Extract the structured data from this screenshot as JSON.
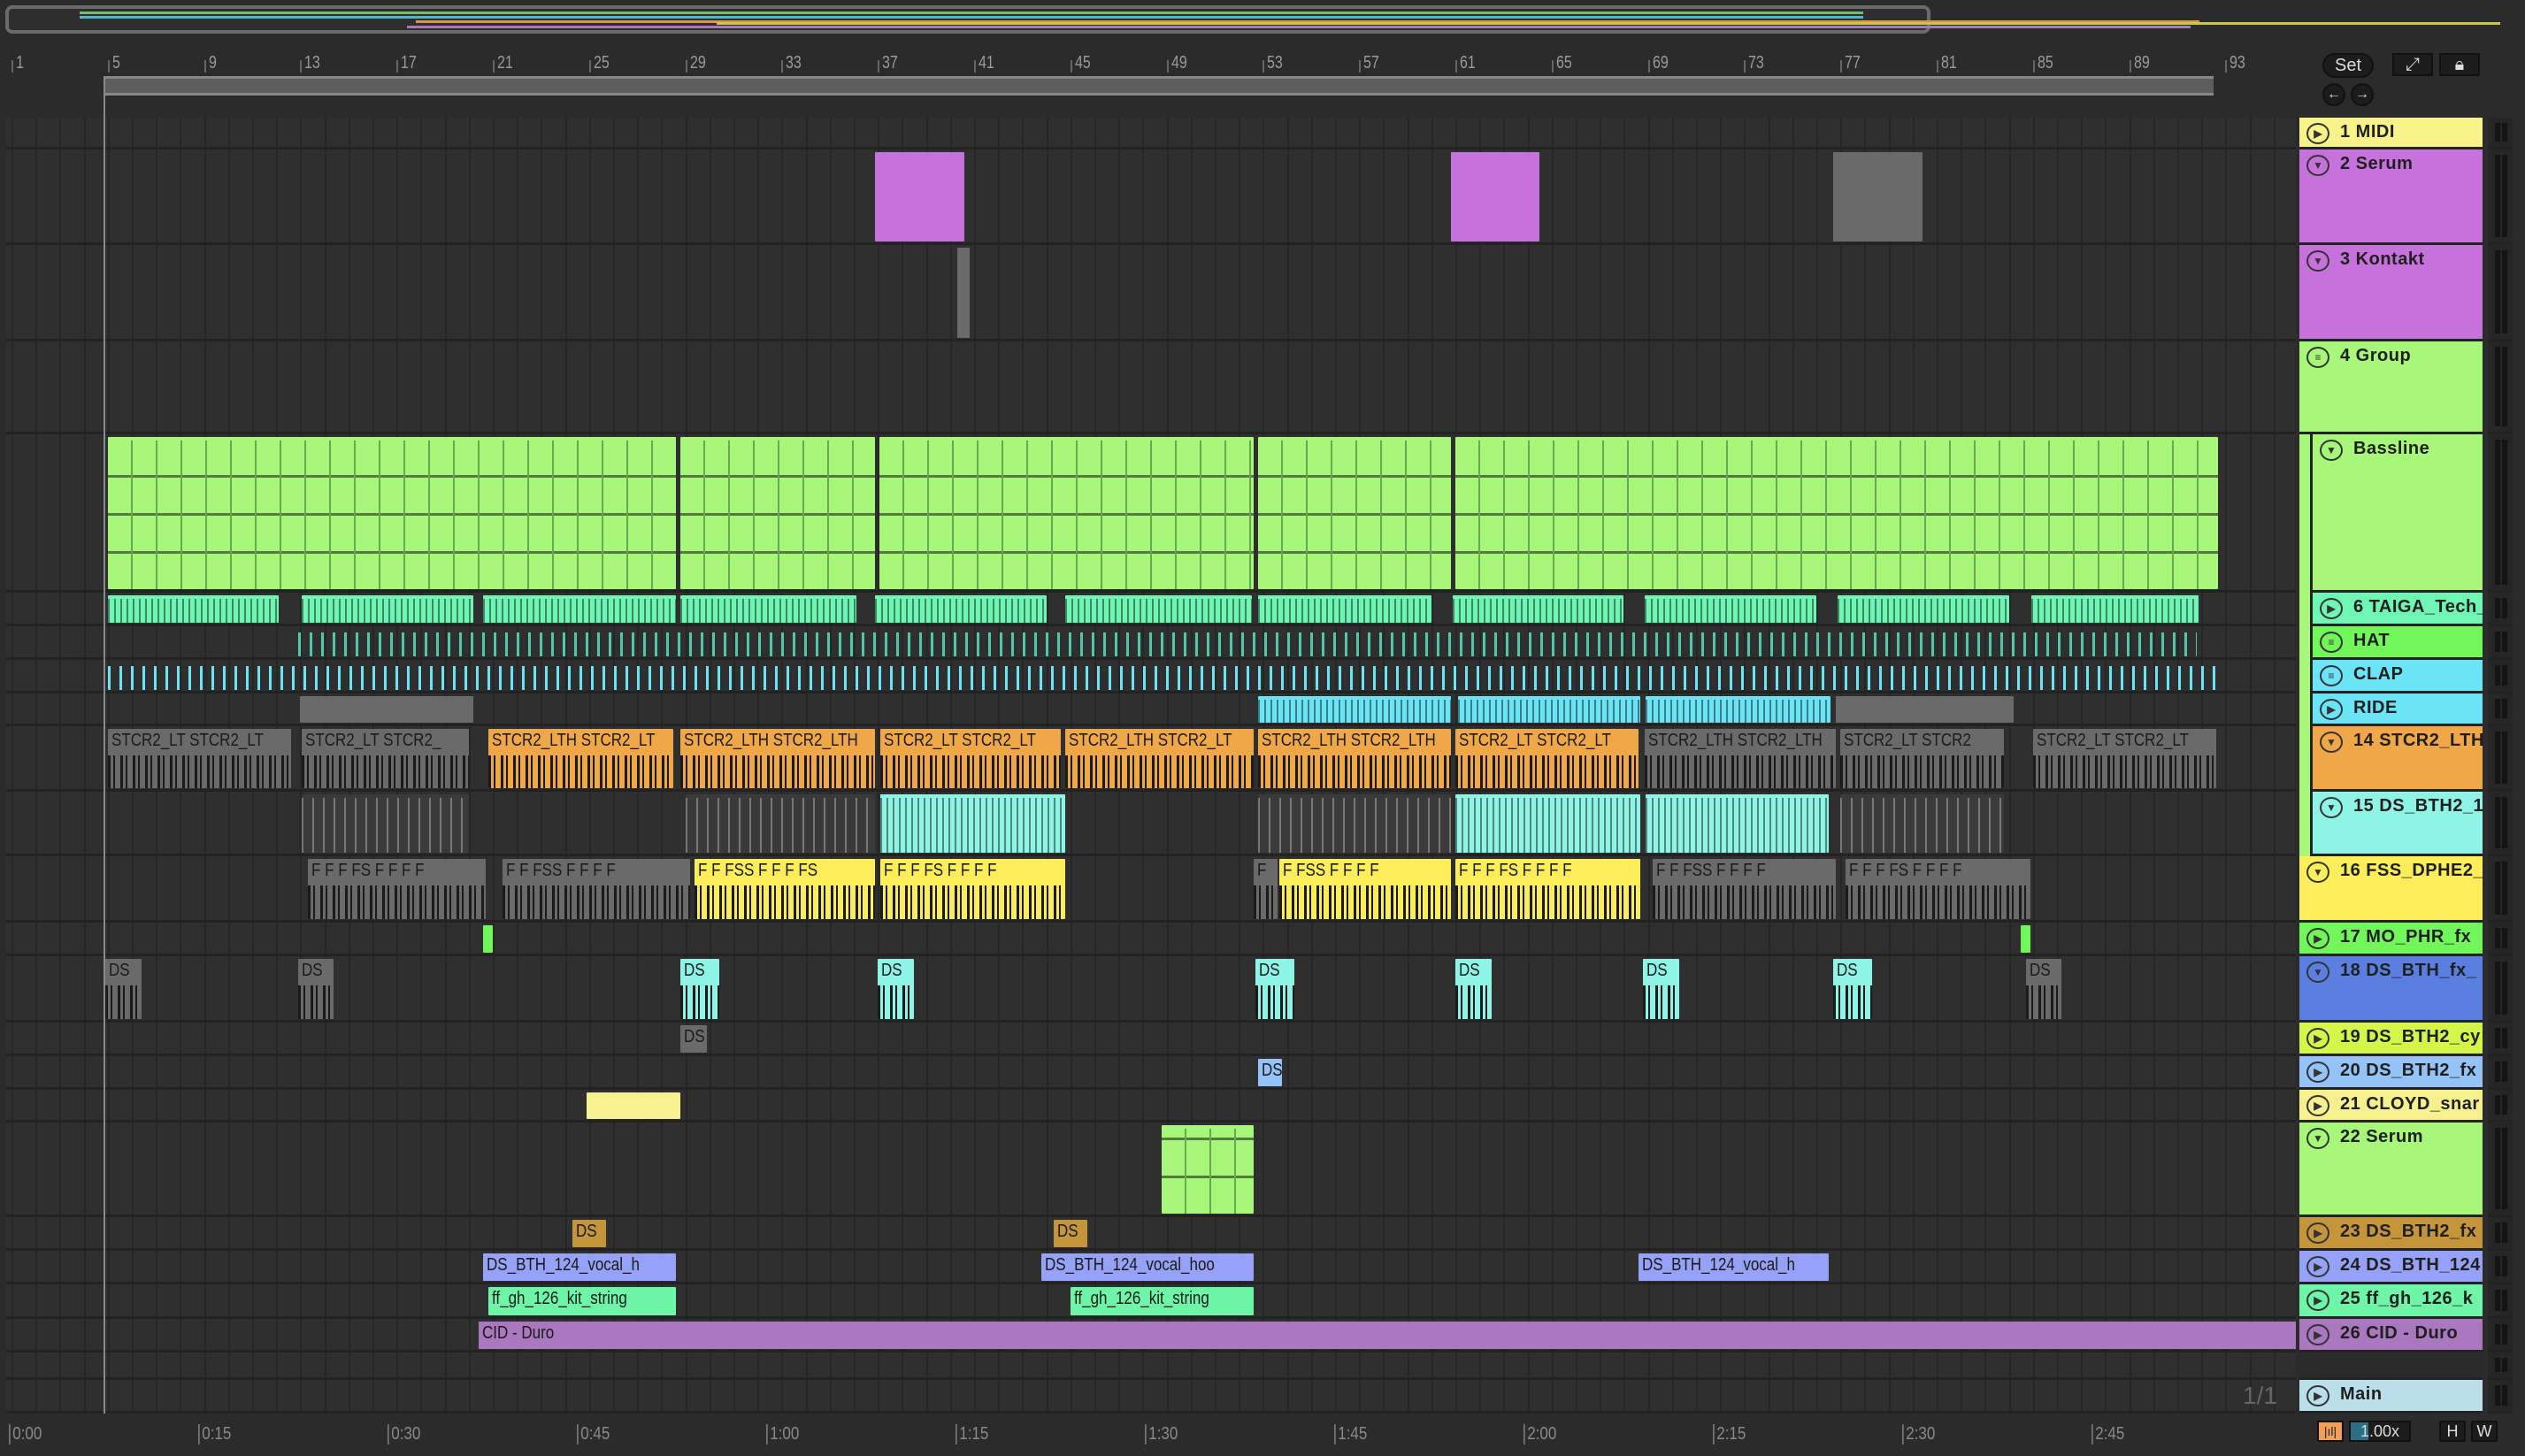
{
  "toolbar": {
    "set_label": "Set",
    "expand_icon": "expand-icon",
    "lock_icon": "lock-icon",
    "back_icon": "arrow-left-icon",
    "forward_icon": "arrow-right-icon"
  },
  "ruler": {
    "bars": [
      1,
      5,
      9,
      13,
      17,
      21,
      25,
      29,
      33,
      37,
      41,
      45,
      49,
      53,
      57,
      61,
      65,
      69,
      73,
      77,
      81,
      85,
      89,
      93
    ]
  },
  "time_ruler": {
    "labels": [
      "0:00",
      "0:15",
      "0:30",
      "0:45",
      "1:00",
      "1:15",
      "1:30",
      "1:45",
      "2:00",
      "2:15",
      "2:30",
      "2:45"
    ]
  },
  "pager": "1/1",
  "bottom": {
    "tempo_icon": "tempo-follow-icon",
    "zoom": "1.00x",
    "h_label": "H",
    "w_label": "W"
  },
  "tracks": [
    {
      "name": "1 MIDI",
      "color": "#f7f38a",
      "icon": "play",
      "clips": []
    },
    {
      "name": "2 Serum",
      "color": "#c772dc",
      "icon": "fold",
      "clips": [
        {
          "s": 36.9,
          "e": 40.6,
          "c": "#c772dc"
        },
        {
          "s": 60.8,
          "e": 64.5,
          "c": "#c772dc"
        },
        {
          "s": 76.7,
          "e": 80.4,
          "c": "#6a6a6a"
        }
      ]
    },
    {
      "name": "3 Kontakt",
      "color": "#c772dc",
      "icon": "fold",
      "clips": [
        {
          "s": 40.3,
          "e": 40.8,
          "c": "#6a6a6a"
        }
      ]
    },
    {
      "name": "4 Group",
      "color": "#a6f77a",
      "icon": "group",
      "clips": []
    },
    {
      "name": "Bassline",
      "color": "#a6f77a",
      "icon": "fold",
      "indent": true,
      "clips": [
        {
          "s": 5,
          "e": 28.6,
          "c": "#a6f77a",
          "w": "midi"
        },
        {
          "s": 28.8,
          "e": 36.9,
          "c": "#a6f77a",
          "w": "midi"
        },
        {
          "s": 37.05,
          "e": 52.6,
          "c": "#a6f77a",
          "w": "midi"
        },
        {
          "s": 52.8,
          "e": 60.8,
          "c": "#a6f77a",
          "w": "midi"
        },
        {
          "s": 61,
          "e": 92.7,
          "c": "#a6f77a",
          "w": "midi"
        }
      ]
    },
    {
      "name": "6 TAIGA_Tech_",
      "color": "#6ff5b4",
      "icon": "play",
      "indent": true,
      "clips": [
        {
          "s": 5,
          "e": 12.1,
          "c": "#6ff5b4",
          "w": "dense"
        },
        {
          "s": 13.05,
          "e": 20.2,
          "c": "#6ff5b4",
          "w": "dense"
        },
        {
          "s": 20.6,
          "e": 28.6,
          "c": "#6ff5b4",
          "w": "dense"
        },
        {
          "s": 28.8,
          "e": 36.1,
          "c": "#6ff5b4",
          "w": "dense"
        },
        {
          "s": 36.9,
          "e": 44,
          "c": "#6ff5b4",
          "w": "dense"
        },
        {
          "s": 44.8,
          "e": 52.55,
          "c": "#6ff5b4",
          "w": "dense"
        },
        {
          "s": 52.8,
          "e": 60,
          "c": "#6ff5b4",
          "w": "dense"
        },
        {
          "s": 60.9,
          "e": 68,
          "c": "#6ff5b4",
          "w": "dense"
        },
        {
          "s": 68.85,
          "e": 76,
          "c": "#6ff5b4",
          "w": "dense"
        },
        {
          "s": 76.9,
          "e": 84,
          "c": "#6ff5b4",
          "w": "dense"
        },
        {
          "s": 84.95,
          "e": 91.9,
          "c": "#6ff5b4",
          "w": "dense"
        }
      ]
    },
    {
      "name": "HAT",
      "color": "#72f75a",
      "icon": "group",
      "indent": true,
      "clips": [
        {
          "s": 12.9,
          "e": 91.8,
          "c": "#4fc7a8",
          "w": "hat"
        }
      ]
    },
    {
      "name": "CLAP",
      "color": "#6ce4f7",
      "icon": "group",
      "indent": true,
      "clips": [
        {
          "s": 5,
          "e": 92.7,
          "c": "#6ce4f7",
          "w": "hat"
        }
      ]
    },
    {
      "name": "RIDE",
      "color": "#6ce4f7",
      "icon": "play",
      "indent": true,
      "clips": [
        {
          "s": 13,
          "e": 20.2,
          "c": "#6a6a6a"
        },
        {
          "s": 52.8,
          "e": 60.8,
          "c": "#6ce4f7",
          "w": "dense"
        },
        {
          "s": 61.1,
          "e": 68.7,
          "c": "#6ce4f7",
          "w": "dense"
        },
        {
          "s": 68.9,
          "e": 76.6,
          "c": "#6ce4f7",
          "w": "dense"
        },
        {
          "s": 76.8,
          "e": 84.2,
          "c": "#6a6a6a"
        }
      ]
    },
    {
      "name": "14 STCR2_LTH",
      "color": "#f0a747",
      "icon": "fold",
      "indent": true,
      "clips": [
        {
          "s": 5,
          "e": 12.6,
          "c": "#6a6a6a",
          "l": "STCR2_LT STCR2_LT",
          "w": "audio"
        },
        {
          "s": 13.05,
          "e": 20,
          "c": "#6a6a6a",
          "l": "STCR2_LT STCR2_",
          "w": "audio"
        },
        {
          "s": 20.8,
          "e": 28.5,
          "c": "#f0a747",
          "l": "STCR2_LTH STCR2_LT",
          "w": "audio"
        },
        {
          "s": 28.8,
          "e": 36.9,
          "c": "#f0a747",
          "l": "STCR2_LTH STCR2_LTH",
          "w": "audio"
        },
        {
          "s": 37.1,
          "e": 44.6,
          "c": "#f0a747",
          "l": "STCR2_LT STCR2_LT",
          "w": "audio"
        },
        {
          "s": 44.8,
          "e": 52.6,
          "c": "#f0a747",
          "l": "STCR2_LTH STCR2_LT",
          "w": "audio"
        },
        {
          "s": 52.8,
          "e": 60.8,
          "c": "#f0a747",
          "l": "STCR2_LTH STCR2_LTH",
          "w": "audio"
        },
        {
          "s": 61,
          "e": 68.6,
          "c": "#f0a747",
          "l": "STCR2_LT STCR2_LT",
          "w": "audio"
        },
        {
          "s": 68.85,
          "e": 76.8,
          "c": "#6a6a6a",
          "l": "STCR2_LTH STCR2_LTH",
          "w": "audio"
        },
        {
          "s": 77,
          "e": 83.8,
          "c": "#6a6a6a",
          "l": "STCR2_LT STCR2",
          "w": "audio"
        },
        {
          "s": 85,
          "e": 92.6,
          "c": "#6a6a6a",
          "l": "STCR2_LT STCR2_LT",
          "w": "audio"
        }
      ]
    },
    {
      "name": "15 DS_BTH2_1",
      "color": "#8ef5e6",
      "icon": "fold",
      "indent": true,
      "clips": [
        {
          "s": 13.05,
          "e": 20,
          "c": "#3a3a3a",
          "w": "lines"
        },
        {
          "s": 29,
          "e": 36.9,
          "c": "#3a3a3a",
          "w": "lines"
        },
        {
          "s": 37.1,
          "e": 44.8,
          "c": "#8ef5e6",
          "w": "dense"
        },
        {
          "s": 52.8,
          "e": 60.8,
          "c": "#3a3a3a",
          "w": "lines"
        },
        {
          "s": 61,
          "e": 68.7,
          "c": "#8ef5e6",
          "w": "dense"
        },
        {
          "s": 68.9,
          "e": 76.5,
          "c": "#8ef5e6",
          "w": "dense"
        },
        {
          "s": 77,
          "e": 83.8,
          "c": "#3a3a3a",
          "w": "lines"
        }
      ]
    },
    {
      "name": "16 FSS_DPHE2_",
      "color": "#fcee5a",
      "icon": "fold",
      "clips": [
        {
          "s": 13.3,
          "e": 20.7,
          "c": "#6a6a6a",
          "l": "F  F  F FS  F  F  F F",
          "w": "audio"
        },
        {
          "s": 21.4,
          "e": 29.2,
          "c": "#6a6a6a",
          "l": "F  F  FSS  F  F  F F",
          "w": "audio"
        },
        {
          "s": 29.4,
          "e": 36.9,
          "c": "#fcee5a",
          "l": "F  F  FSS  F  F  F FS",
          "w": "audio"
        },
        {
          "s": 37.1,
          "e": 44.8,
          "c": "#fcee5a",
          "l": "F  F  F FS  F  F  F F",
          "w": "audio"
        },
        {
          "s": 52.6,
          "e": 53.6,
          "c": "#6a6a6a",
          "l": "F",
          "w": "audio"
        },
        {
          "s": 53.7,
          "e": 60.8,
          "c": "#fcee5a",
          "l": "F  FSS  F  F  F F",
          "w": "audio"
        },
        {
          "s": 61,
          "e": 68.7,
          "c": "#fcee5a",
          "l": "F  F  F FS  F  F  F F",
          "w": "audio"
        },
        {
          "s": 69.2,
          "e": 76.8,
          "c": "#6a6a6a",
          "l": "F  F  FSS  F  F  F F",
          "w": "audio"
        },
        {
          "s": 77.2,
          "e": 84.9,
          "c": "#6a6a6a",
          "l": "F  F  F FS  F  F  F F",
          "w": "audio"
        }
      ]
    },
    {
      "name": "17 MO_PHR_fx",
      "color": "#72f75a",
      "icon": "play",
      "clips": [
        {
          "s": 20.6,
          "e": 21,
          "c": "#72f75a"
        },
        {
          "s": 84.5,
          "e": 84.9,
          "c": "#72f75a"
        }
      ]
    },
    {
      "name": "18 DS_BTH_fx_",
      "color": "#5b7fe0",
      "icon": "fold",
      "clips": [
        {
          "s": 4.9,
          "e": 6.4,
          "c": "#6a6a6a",
          "l": "DS",
          "w": "audio"
        },
        {
          "s": 12.9,
          "e": 14.4,
          "c": "#6a6a6a",
          "l": "DS",
          "w": "audio"
        },
        {
          "s": 28.8,
          "e": 30.4,
          "c": "#8ef5e6",
          "l": "DS",
          "w": "audio"
        },
        {
          "s": 37,
          "e": 38.5,
          "c": "#8ef5e6",
          "l": "DS",
          "w": "audio"
        },
        {
          "s": 52.7,
          "e": 54.3,
          "c": "#8ef5e6",
          "l": "DS",
          "w": "audio"
        },
        {
          "s": 61,
          "e": 62.5,
          "c": "#8ef5e6",
          "l": "DS",
          "w": "audio"
        },
        {
          "s": 68.8,
          "e": 70.3,
          "c": "#8ef5e6",
          "l": "DS",
          "w": "audio"
        },
        {
          "s": 76.7,
          "e": 78.3,
          "c": "#8ef5e6",
          "l": "DS",
          "w": "audio"
        },
        {
          "s": 84.7,
          "e": 86.2,
          "c": "#6a6a6a",
          "l": "DS",
          "w": "audio"
        }
      ]
    },
    {
      "name": "19 DS_BTH2_cy",
      "color": "#d4f54a",
      "icon": "play",
      "clips": [
        {
          "s": 28.8,
          "e": 29.9,
          "c": "#6a6a6a",
          "l": "DS"
        }
      ]
    },
    {
      "name": "20 DS_BTH2_fx",
      "color": "#95c2f7",
      "icon": "play",
      "clips": [
        {
          "s": 52.8,
          "e": 53.8,
          "c": "#95c2f7",
          "l": "DS"
        }
      ]
    },
    {
      "name": "21 CLOYD_snar",
      "color": "#f7f08f",
      "icon": "play",
      "clips": [
        {
          "s": 24.9,
          "e": 28.8,
          "c": "#f7f08f"
        }
      ]
    },
    {
      "name": "22 Serum",
      "color": "#a6f77a",
      "icon": "fold",
      "clips": [
        {
          "s": 48.8,
          "e": 52.6,
          "c": "#a6f77a",
          "w": "midi"
        }
      ]
    },
    {
      "name": "23 DS_BTH2_fx",
      "color": "#c4953a",
      "icon": "play",
      "clips": [
        {
          "s": 24.3,
          "e": 25.7,
          "c": "#c4953a",
          "l": "DS"
        },
        {
          "s": 44.3,
          "e": 45.7,
          "c": "#c4953a",
          "l": "DS"
        }
      ]
    },
    {
      "name": "24 DS_BTH_124",
      "color": "#95a2f7",
      "icon": "play",
      "clips": [
        {
          "s": 20.6,
          "e": 28.6,
          "c": "#95a2f7",
          "l": "DS_BTH_124_vocal_h"
        },
        {
          "s": 43.8,
          "e": 52.6,
          "c": "#95a2f7",
          "l": "DS_BTH_124_vocal_hoo"
        },
        {
          "s": 68.6,
          "e": 76.5,
          "c": "#95a2f7",
          "l": "DS_BTH_124_vocal_h"
        }
      ]
    },
    {
      "name": "25 ff_gh_126_k",
      "color": "#6ff5a8",
      "icon": "play",
      "clips": [
        {
          "s": 20.8,
          "e": 28.6,
          "c": "#6ff5a8",
          "l": "ff_gh_126_kit_string"
        },
        {
          "s": 45,
          "e": 52.6,
          "c": "#6ff5a8",
          "l": "ff_gh_126_kit_string"
        }
      ]
    },
    {
      "name": "26 CID - Duro",
      "color": "#a978bf",
      "icon": "play",
      "clips": [
        {
          "s": 20.4,
          "e": 96,
          "c": "#a978bf",
          "l": "CID - Duro"
        }
      ]
    },
    {
      "name": "",
      "color": "#2b2b2b",
      "icon": "",
      "clips": []
    },
    {
      "name": "Main",
      "color": "#b9dfea",
      "icon": "play",
      "clips": []
    }
  ]
}
